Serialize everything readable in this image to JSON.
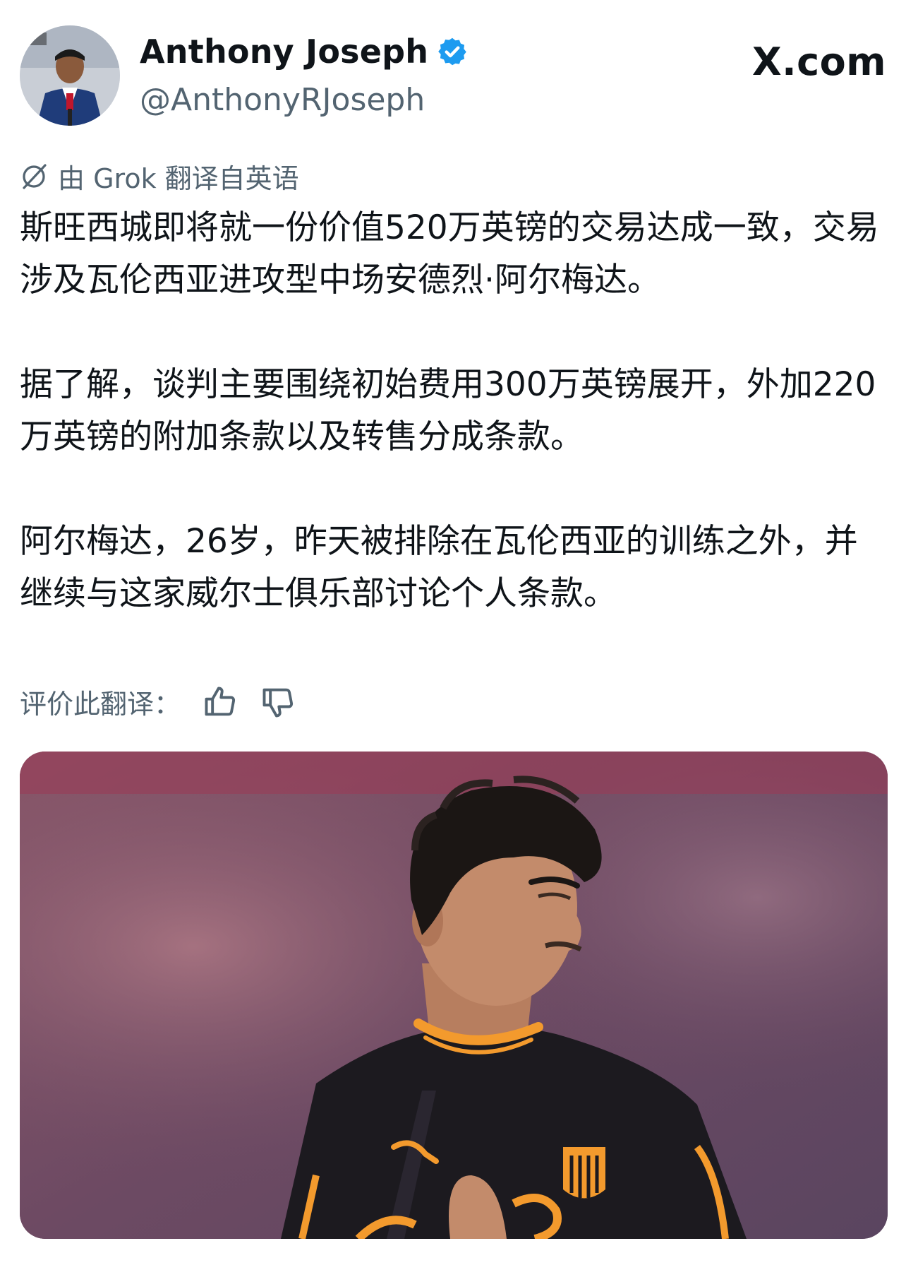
{
  "author": {
    "display_name": "Anthony Joseph",
    "handle": "@AnthonyRJoseph",
    "verified": true,
    "avatar_icon": "avatar-photo"
  },
  "brand": {
    "text": "X.com"
  },
  "translation": {
    "label": "由 Grok 翻译自英语",
    "rate_label": "评价此翻译：",
    "icons": [
      "grok-icon",
      "thumbs-up-icon",
      "thumbs-down-icon"
    ]
  },
  "tweet": {
    "paragraphs": [
      "斯旺西城即将就一份价值520万英镑的交易达成一致，交易涉及瓦伦西亚进攻型中场安德烈·阿尔梅达。",
      "据了解，谈判主要围绕初始费用300万英镑展开，外加220万英镑的附加条款以及转售分成条款。",
      "阿尔梅达，26岁，昨天被排除在瓦伦西亚的训练之外，并继续与这家威尔士俱乐部讨论个人条款。"
    ]
  },
  "colors": {
    "verified_blue": "#1d9bf0",
    "secondary_text": "#536471",
    "jersey_orange": "#f39a2d"
  }
}
